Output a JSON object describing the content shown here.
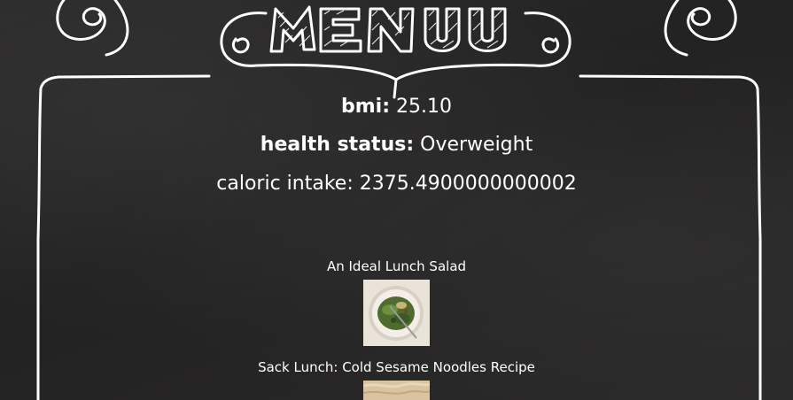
{
  "header": {
    "menu_title": "MENU"
  },
  "stats": {
    "bmi_label": "bmi:",
    "bmi_value": "25.10",
    "health_label": "health status:",
    "health_value": "Overweight",
    "caloric_label": "caloric intake:",
    "caloric_value": "2375.4900000000002"
  },
  "recipes": [
    {
      "title": "An Ideal Lunch Salad",
      "image_icon": "salad-bowl-photo"
    },
    {
      "title": "Sack Lunch: Cold Sesame Noodles Recipe",
      "image_icon": "noodles-photo"
    }
  ],
  "colors": {
    "chalkboard": "#262525",
    "chalk": "#ffffff"
  }
}
